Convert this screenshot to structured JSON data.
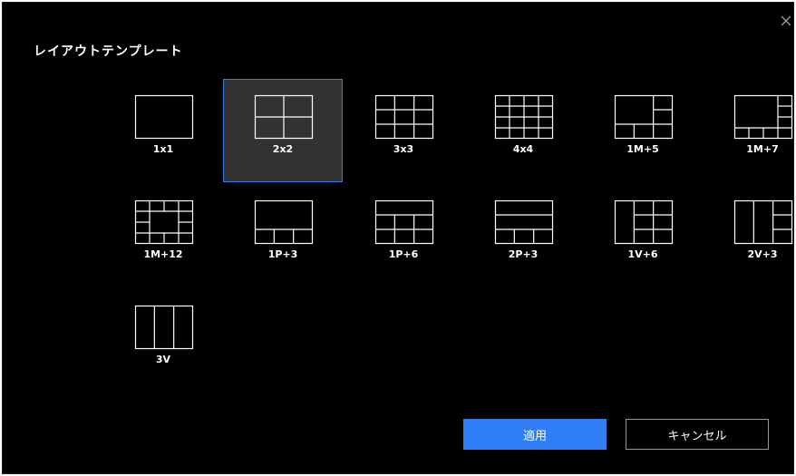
{
  "dialog": {
    "title": "レイアウトテンプレート",
    "close_icon": "close-icon"
  },
  "templates": [
    {
      "id": "1x1",
      "label": "1x1",
      "selected": false
    },
    {
      "id": "2x2",
      "label": "2x2",
      "selected": true
    },
    {
      "id": "3x3",
      "label": "3x3",
      "selected": false
    },
    {
      "id": "4x4",
      "label": "4x4",
      "selected": false
    },
    {
      "id": "1M+5",
      "label": "1M+5",
      "selected": false
    },
    {
      "id": "1M+7",
      "label": "1M+7",
      "selected": false
    },
    {
      "id": "1M+12",
      "label": "1M+12",
      "selected": false
    },
    {
      "id": "1P+3",
      "label": "1P+3",
      "selected": false
    },
    {
      "id": "1P+6",
      "label": "1P+6",
      "selected": false
    },
    {
      "id": "2P+3",
      "label": "2P+3",
      "selected": false
    },
    {
      "id": "1V+6",
      "label": "1V+6",
      "selected": false
    },
    {
      "id": "2V+3",
      "label": "2V+3",
      "selected": false
    },
    {
      "id": "3V",
      "label": "3V",
      "selected": false
    }
  ],
  "buttons": {
    "apply_label": "適用",
    "cancel_label": "キャンセル"
  },
  "colors": {
    "background": "#000000",
    "selection_fill": "#323232",
    "selection_border": "#3a78e6",
    "primary": "#2f7ef5",
    "secondary_border": "#9a9a9a"
  }
}
